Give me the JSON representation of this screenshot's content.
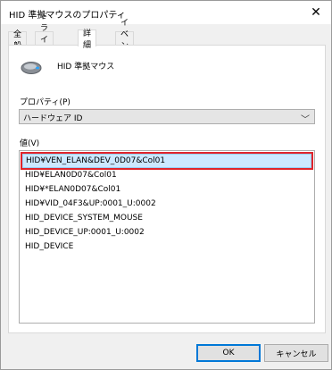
{
  "window": {
    "title": "HID 準拠マウスのプロパティ",
    "close_glyph": "✕"
  },
  "tabs": [
    {
      "label": "全般",
      "active": false
    },
    {
      "label": "ドライバー",
      "active": false
    },
    {
      "label": "詳細",
      "active": true
    },
    {
      "label": "イベント",
      "active": false
    }
  ],
  "device": {
    "name": "HID 準拠マウス",
    "icon": "mouse-icon"
  },
  "property": {
    "label": "プロパティ(P)",
    "selected": "ハードウェア ID",
    "chevron": "﹀"
  },
  "values": {
    "label": "値(V)",
    "items": [
      "HID¥VEN_ELAN&DEV_0D07&Col01",
      "HID¥ELAN0D07&Col01",
      "HID¥*ELAN0D07&Col01",
      "HID¥VID_04F3&UP:0001_U:0002",
      "HID_DEVICE_SYSTEM_MOUSE",
      "HID_DEVICE_UP:0001_U:0002",
      "HID_DEVICE"
    ],
    "selected_index": 0
  },
  "buttons": {
    "ok": "OK",
    "cancel": "キャンセル"
  },
  "colors": {
    "highlight_border": "#e0242a",
    "selection_bg": "#cce8ff",
    "ok_border": "#0078d7"
  }
}
